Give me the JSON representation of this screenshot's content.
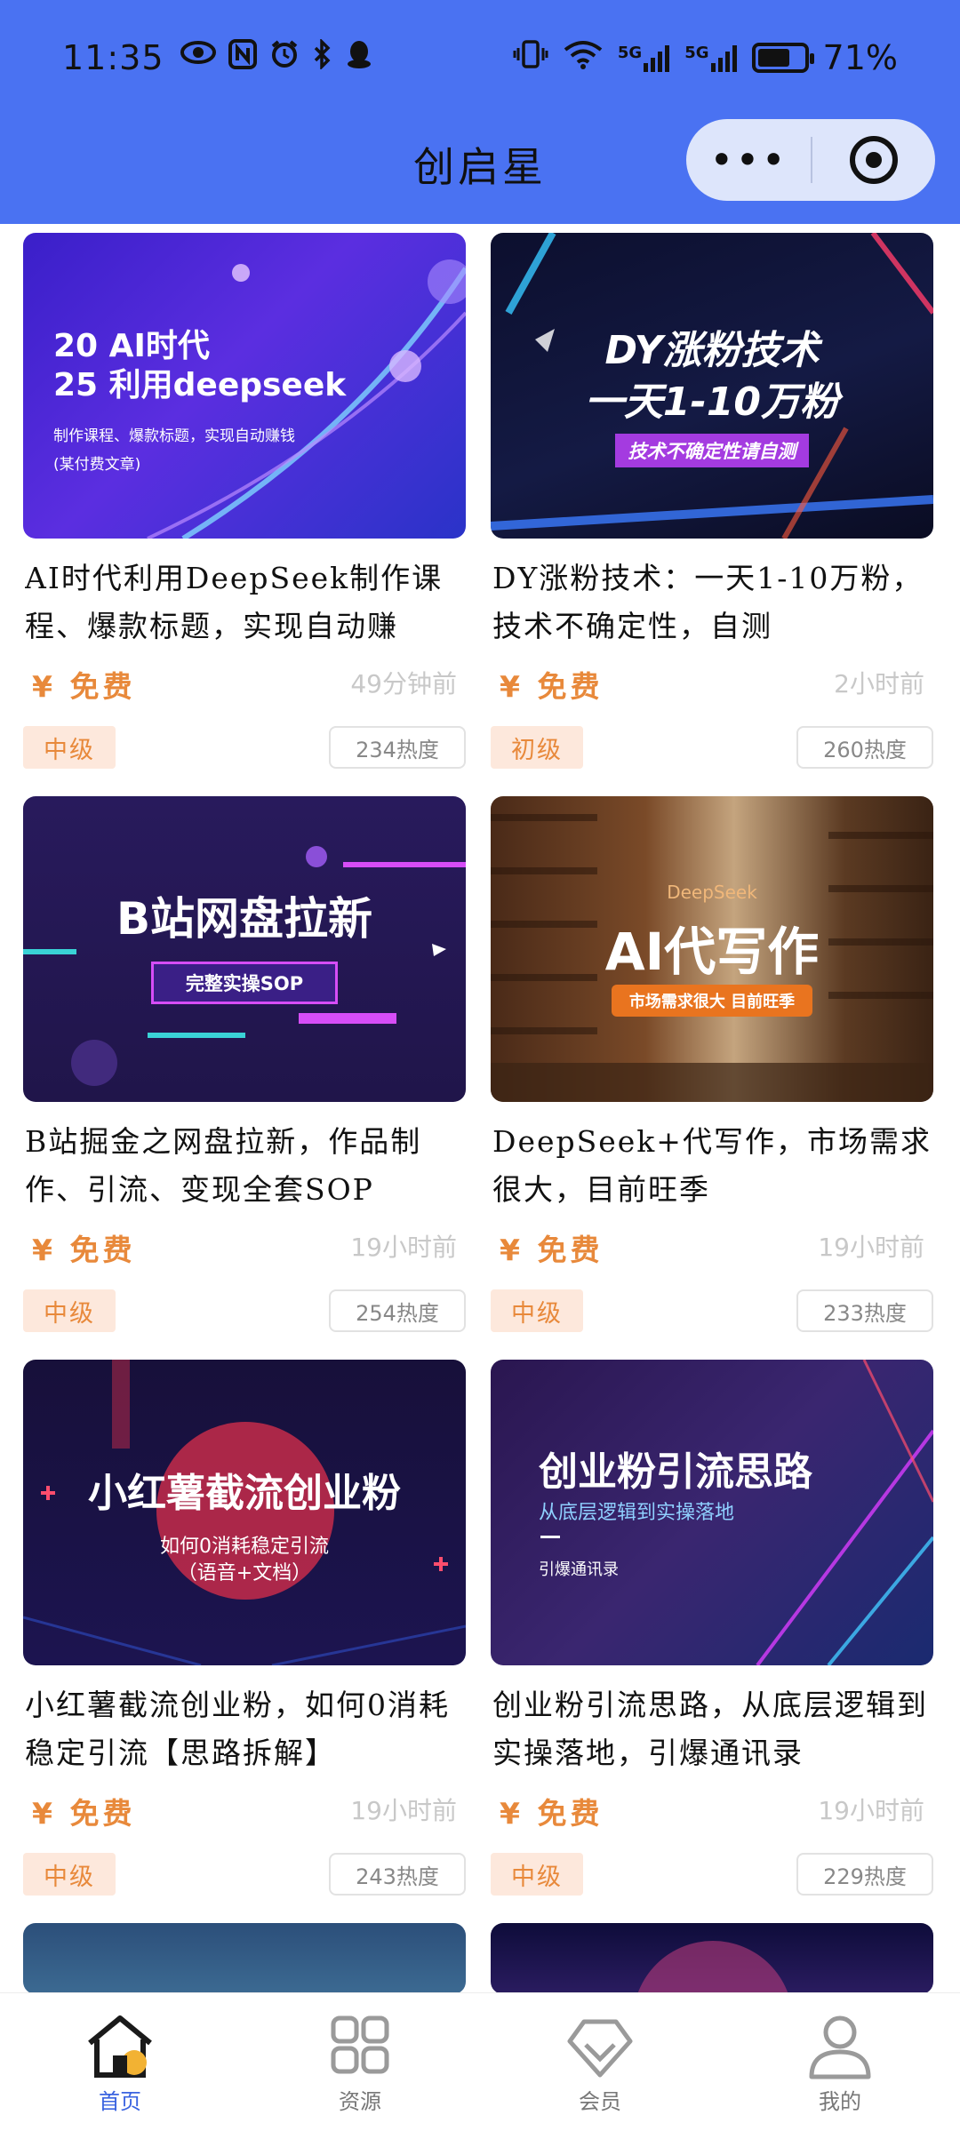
{
  "status_bar": {
    "time": "11:35",
    "battery": "71%",
    "battery_level": 0.71,
    "network_1": "5G",
    "network_2": "5G"
  },
  "app": {
    "title": "创启星",
    "more_icon": "ellipsis-icon",
    "close_icon": "target-icon"
  },
  "cards": [
    {
      "thumb_line1": "20 AI时代",
      "thumb_line2": "25 利用deepseek",
      "thumb_sub": "制作课程、爆款标题，实现自动赚钱",
      "thumb_tag": "(某付费文章)",
      "title": "AI时代利用DeepSeek制作课程、爆款标题，实现自动赚",
      "price": "¥ 免费",
      "ago": "49分钟前",
      "level": "中级",
      "heat": "234热度"
    },
    {
      "thumb_line1": "DY涨粉技术",
      "thumb_line2": "一天1-10万粉",
      "thumb_sub": "技术不确定性请自测",
      "title": "DY涨粉技术：一天1-10万粉，技术不确定性，自测",
      "price": "¥ 免费",
      "ago": "2小时前",
      "level": "初级",
      "heat": "260热度"
    },
    {
      "thumb_line1": "B站网盘拉新",
      "thumb_sub": "完整实操SOP",
      "title": "B站掘金之网盘拉新，作品制作、引流、变现全套SOP",
      "price": "¥ 免费",
      "ago": "19小时前",
      "level": "中级",
      "heat": "254热度"
    },
    {
      "thumb_tag": "DeepSeek",
      "thumb_line1": "AI代写作",
      "thumb_sub": "市场需求很大 目前旺季",
      "title": "DeepSeek+代写作，市场需求很大，目前旺季",
      "price": "¥ 免费",
      "ago": "19小时前",
      "level": "中级",
      "heat": "233热度"
    },
    {
      "thumb_line1": "小红薯截流创业粉",
      "thumb_line2": "如何0消耗稳定引流",
      "thumb_sub": "（语音+文档）",
      "title": "小红薯截流创业粉，如何0消耗稳定引流【思路拆解】",
      "price": "¥ 免费",
      "ago": "19小时前",
      "level": "中级",
      "heat": "243热度"
    },
    {
      "thumb_line1": "创业粉引流思路",
      "thumb_line2": "从底层逻辑到实操落地",
      "thumb_sub": "引爆通讯录",
      "title": "创业粉引流思路，从底层逻辑到实操落地，引爆通讯录",
      "price": "¥ 免费",
      "ago": "19小时前",
      "level": "中级",
      "heat": "229热度"
    }
  ],
  "tabbar": {
    "tabs": [
      {
        "label": "首页",
        "icon": "home-icon",
        "active": true
      },
      {
        "label": "资源",
        "icon": "grid-icon",
        "active": false
      },
      {
        "label": "会员",
        "icon": "diamond-icon",
        "active": false
      },
      {
        "label": "我的",
        "icon": "user-icon",
        "active": false
      }
    ]
  },
  "colors": {
    "header_bg": "#4a72f2",
    "accent_orange": "#e8893b",
    "active_tab": "#3a63e0"
  }
}
